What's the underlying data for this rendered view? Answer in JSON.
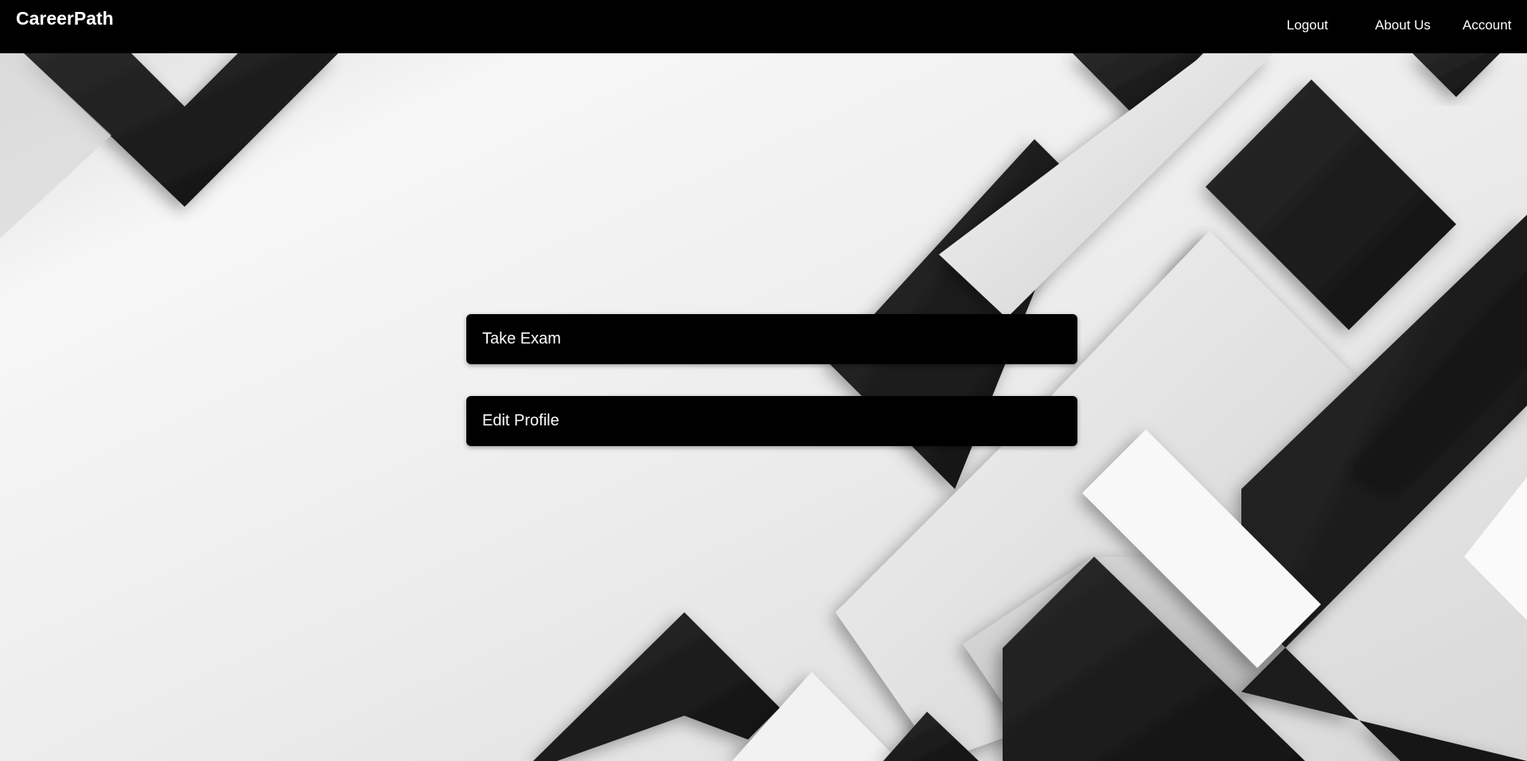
{
  "navbar": {
    "brand": "CareerPath",
    "links": {
      "logout": "Logout",
      "about": "About Us",
      "account": "Account"
    }
  },
  "main": {
    "buttons": {
      "take_exam": "Take Exam",
      "edit_profile": "Edit Profile"
    }
  },
  "colors": {
    "navbar_bg": "#000000",
    "button_bg": "#000000",
    "button_text": "#ffffff",
    "background_light": "#eeeeee",
    "background_dark": "#1a1a1a"
  }
}
